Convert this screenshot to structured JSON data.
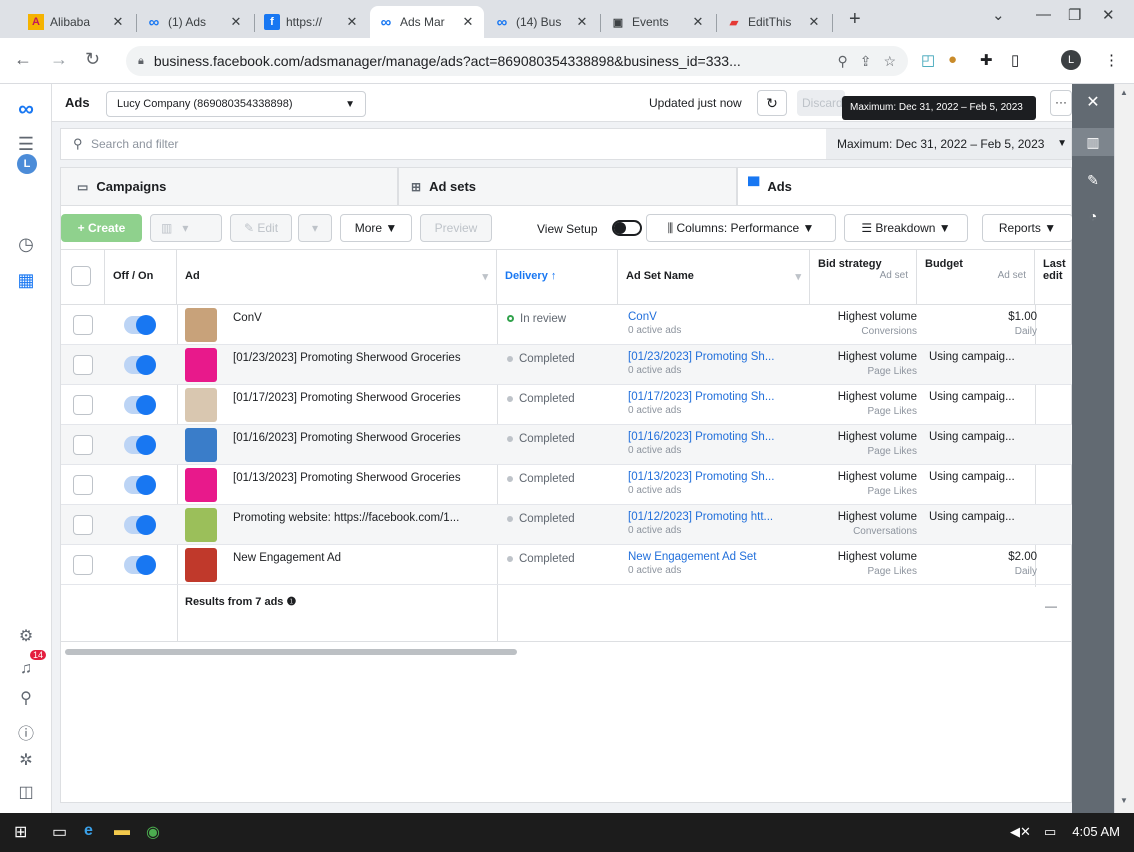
{
  "browser": {
    "tabs": [
      {
        "title": "Alibaba",
        "fav": "A"
      },
      {
        "title": "(1) Ads",
        "fav": "∞"
      },
      {
        "title": "https://",
        "fav": "f"
      },
      {
        "title": "Ads Mar",
        "fav": "∞"
      },
      {
        "title": "(14) Bus",
        "fav": "∞"
      },
      {
        "title": "Events",
        "fav": "▣"
      },
      {
        "title": "EditThis",
        "fav": "▰"
      }
    ],
    "url": "business.facebook.com/adsmanager/manage/ads?act=869080354338898&business_id=333..."
  },
  "header": {
    "app_title": "Ads",
    "account": "Lucy Company (869080354338898)",
    "updated": "Updated just now",
    "discard": "Discard",
    "tooltip": "Maximum: Dec 31, 2022 – Feb 5, 2023",
    "more": "···"
  },
  "filter": {
    "placeholder": "Search and filter",
    "date_range": "Maximum: Dec 31, 2022 – Feb 5, 2023"
  },
  "level_tabs": {
    "campaigns": "Campaigns",
    "adsets": "Ad sets",
    "ads": "Ads"
  },
  "actions": {
    "create": "+ Create",
    "edit": "Edit",
    "more": "More ▼",
    "preview": "Preview",
    "view_setup": "View Setup",
    "columns": "Columns: Performance ▼",
    "breakdown": "Breakdown ▼",
    "reports": "Reports ▼"
  },
  "columns": {
    "offon": "Off / On",
    "ad": "Ad",
    "delivery": "Delivery ↑",
    "adset_name": "Ad Set Name",
    "bid_strategy": "Bid strategy",
    "bid_sub": "Ad set",
    "budget": "Budget",
    "budget_sub": "Ad set",
    "last_edit": "Last edit"
  },
  "rows": [
    {
      "ad": "ConV",
      "delivery": "In review",
      "adset": "ConV",
      "adset_sub": "0 active ads",
      "bid": "Highest volume",
      "bid_sub": "Conversions",
      "budget": "$1.00",
      "budget_sub": "Daily",
      "thumb": "#c8a27a"
    },
    {
      "ad": "[01/23/2023] Promoting Sherwood Groceries",
      "delivery": "Completed",
      "adset": "[01/23/2023] Promoting Sh...",
      "adset_sub": "0 active ads",
      "bid": "Highest volume",
      "bid_sub": "Page Likes",
      "budget": "Using campaig...",
      "budget_sub": "",
      "thumb": "#e8198b"
    },
    {
      "ad": "[01/17/2023] Promoting Sherwood Groceries",
      "delivery": "Completed",
      "adset": "[01/17/2023] Promoting Sh...",
      "adset_sub": "0 active ads",
      "bid": "Highest volume",
      "bid_sub": "Page Likes",
      "budget": "Using campaig...",
      "budget_sub": "",
      "thumb": "#d9c7b0"
    },
    {
      "ad": "[01/16/2023] Promoting Sherwood Groceries",
      "delivery": "Completed",
      "adset": "[01/16/2023] Promoting Sh...",
      "adset_sub": "0 active ads",
      "bid": "Highest volume",
      "bid_sub": "Page Likes",
      "budget": "Using campaig...",
      "budget_sub": "",
      "thumb": "#3a7dc9"
    },
    {
      "ad": "[01/13/2023] Promoting Sherwood Groceries",
      "delivery": "Completed",
      "adset": "[01/13/2023] Promoting Sh...",
      "adset_sub": "0 active ads",
      "bid": "Highest volume",
      "bid_sub": "Page Likes",
      "budget": "Using campaig...",
      "budget_sub": "",
      "thumb": "#e8198b"
    },
    {
      "ad": "Promoting website: https://facebook.com/1...",
      "delivery": "Completed",
      "adset": "[01/12/2023] Promoting htt...",
      "adset_sub": "0 active ads",
      "bid": "Highest volume",
      "bid_sub": "Conversations",
      "budget": "Using campaig...",
      "budget_sub": "",
      "thumb": "#9bbf5a"
    },
    {
      "ad": "New Engagement Ad",
      "delivery": "Completed",
      "adset": "New Engagement Ad Set",
      "adset_sub": "0 active ads",
      "bid": "Highest volume",
      "bid_sub": "Page Likes",
      "budget": "$2.00",
      "budget_sub": "Daily",
      "thumb": "#c0392b"
    }
  ],
  "results": {
    "label": "Results from 7 ads",
    "last": "—"
  },
  "rail": {
    "avatar": "L",
    "badge": "14"
  },
  "taskbar": {
    "time": "4:05 AM"
  },
  "profile": "L"
}
